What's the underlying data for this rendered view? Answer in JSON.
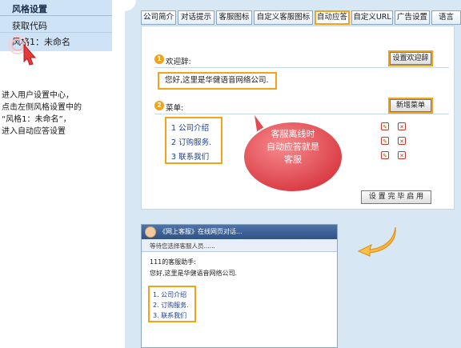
{
  "sidebar": {
    "title": "风格设置",
    "items": [
      {
        "label": "获取代码"
      },
      {
        "label": "风格1：未命名"
      }
    ]
  },
  "instruction": {
    "lines": [
      "进入用户设置中心，",
      "点击左侧风格设置中的",
      "“风格1：未命名”，",
      "进入自动应答设置"
    ]
  },
  "tabs": [
    {
      "label": "公司简介"
    },
    {
      "label": "对话提示"
    },
    {
      "label": "客服图标"
    },
    {
      "label": "自定义客服图标"
    },
    {
      "label": "自动应答",
      "active": true
    },
    {
      "label": "自定义URL"
    },
    {
      "label": "广告设置"
    },
    {
      "label": "语言"
    }
  ],
  "welcome": {
    "number": "1",
    "label": "欢迎辞:",
    "button": "设置欢迎辞",
    "text": "您好,这里是华健语音网络公司."
  },
  "menu": {
    "number": "2",
    "label": "菜单:",
    "button": "新增菜单",
    "items": [
      {
        "label": "1 公司介绍"
      },
      {
        "label": "2 订购服务."
      },
      {
        "label": "3 联系我们"
      }
    ]
  },
  "callout": {
    "lines": [
      "客服离线时",
      "自动应答就是",
      "客服"
    ]
  },
  "finish_button": "设 置 完 毕 启 用",
  "chat_preview": {
    "title": "《网上客服》在线网页对话...",
    "subtitle": "等待您选择客服人员......",
    "assistant_line": "111的客服助手:",
    "greeting": "您好,这里是华健语音网络公司.",
    "items": [
      {
        "label": "1. 公司介绍"
      },
      {
        "label": "2. 订购服务."
      },
      {
        "label": "3. 联系我们"
      }
    ]
  },
  "colors": {
    "accent": "#f2a31b",
    "panel": "#d8e7f4",
    "sidebar": "#cfe3f6",
    "callout": "#e8555c",
    "link": "#1a3d8f"
  }
}
